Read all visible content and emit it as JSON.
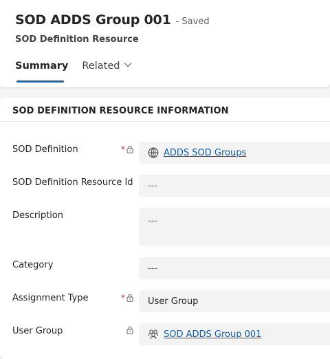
{
  "header": {
    "title": "SOD ADDS Group 001",
    "save_status": "- Saved",
    "entity_name": "SOD Definition Resource"
  },
  "tabs": [
    {
      "label": "Summary",
      "selected": true
    },
    {
      "label": "Related",
      "has_dropdown": true
    }
  ],
  "section": {
    "title": "SOD DEFINITION RESOURCE INFORMATION",
    "fields": [
      {
        "label": "SOD Definition",
        "value": "ADDS SOD Groups",
        "required": true,
        "locked": true,
        "type": "lookup",
        "icon": "globe-icon"
      },
      {
        "label": "SOD Definition Resource Id",
        "value": "---",
        "required": false,
        "locked": false,
        "type": "text"
      },
      {
        "label": "Description",
        "value": "---",
        "required": false,
        "locked": false,
        "type": "multiline"
      },
      {
        "label": "Category",
        "value": "---",
        "required": false,
        "locked": false,
        "type": "text"
      },
      {
        "label": "Assignment Type",
        "value": "User Group",
        "required": true,
        "locked": true,
        "type": "option"
      },
      {
        "label": "User Group",
        "value": "SOD ADDS Group 001",
        "required": false,
        "locked": true,
        "type": "lookup",
        "icon": "people-icon"
      }
    ]
  },
  "required_marker": "*",
  "colors": {
    "accent": "#0f6cbd",
    "link": "#115ea3",
    "required": "#c4314b",
    "field_bg": "#f3f3f3"
  }
}
